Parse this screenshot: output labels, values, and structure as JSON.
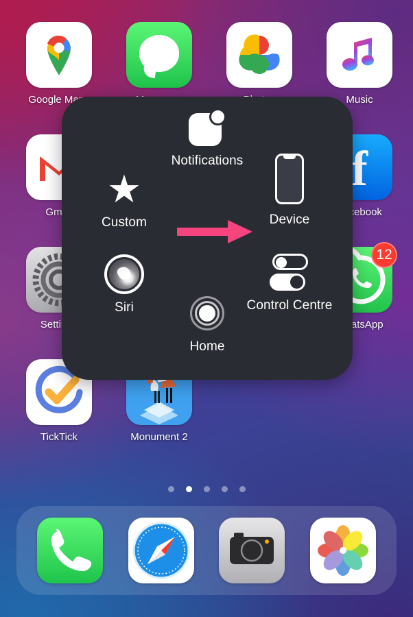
{
  "wallpaper": {
    "colors": [
      "#b01c4e",
      "#5c2c82",
      "#762d96",
      "#1f6aab",
      "#3e287c"
    ]
  },
  "home_screen": {
    "apps": [
      {
        "name": "Google Maps",
        "label": "Google Maps",
        "icon": "google-maps-icon",
        "row": 1,
        "col": 1
      },
      {
        "name": "Messages",
        "label": "Messages",
        "icon": "messages-icon",
        "row": 1,
        "col": 2
      },
      {
        "name": "Google Photos",
        "label": "Photos",
        "icon": "google-photos-icon",
        "row": 1,
        "col": 3
      },
      {
        "name": "Music",
        "label": "Music",
        "icon": "apple-music-icon",
        "row": 1,
        "col": 4
      },
      {
        "name": "Gmail",
        "label": "Gmail",
        "icon": "gmail-icon",
        "row": 2,
        "col": 1
      },
      {
        "name": "Facebook",
        "label": "Facebook",
        "icon": "facebook-icon",
        "row": 2,
        "col": 4
      },
      {
        "name": "Settings",
        "label": "Settings",
        "icon": "settings-icon",
        "row": 3,
        "col": 1
      },
      {
        "name": "WhatsApp",
        "label": "WhatsApp",
        "icon": "whatsapp-icon",
        "row": 3,
        "col": 4,
        "badge": "12"
      },
      {
        "name": "TickTick",
        "label": "TickTick",
        "icon": "ticktick-icon",
        "row": 4,
        "col": 1
      },
      {
        "name": "Monument 2",
        "label": "Monument 2",
        "icon": "monument-valley-icon",
        "row": 4,
        "col": 2
      }
    ],
    "page_dots": {
      "count": 5,
      "active_index": 1
    }
  },
  "dock": {
    "apps": [
      {
        "name": "Phone",
        "icon": "phone-icon"
      },
      {
        "name": "Safari",
        "icon": "safari-compass-icon"
      },
      {
        "name": "Camera",
        "icon": "camera-icon"
      },
      {
        "name": "Photos",
        "icon": "apple-photos-icon"
      }
    ]
  },
  "assistive_touch": {
    "items": [
      {
        "id": "notifications",
        "label": "Notifications",
        "icon": "notification-square-icon"
      },
      {
        "id": "custom",
        "label": "Custom",
        "icon": "star-icon"
      },
      {
        "id": "device",
        "label": "Device",
        "icon": "device-phone-icon"
      },
      {
        "id": "siri",
        "label": "Siri",
        "icon": "siri-orb-icon"
      },
      {
        "id": "home",
        "label": "Home",
        "icon": "home-button-icon"
      },
      {
        "id": "control_centre",
        "label": "Control Centre",
        "icon": "toggles-icon"
      }
    ],
    "panel_color": "#2a2c34"
  },
  "annotation": {
    "arrow": {
      "name": "pink-arrow",
      "points_to": "Device",
      "color": "#f5447e"
    }
  }
}
